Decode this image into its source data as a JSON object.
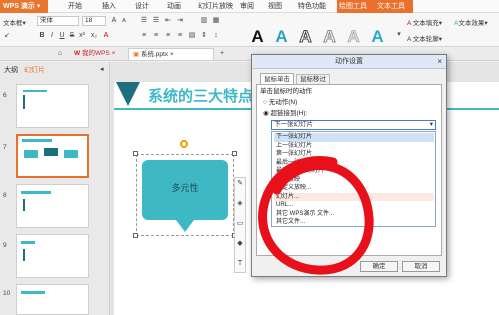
{
  "colors": {
    "accent": "#e9712b",
    "teal": "#3fb8c6",
    "dark_teal": "#1d6f7d",
    "red_annotation": "#e8101a"
  },
  "app": {
    "name": "WPS 演示"
  },
  "menu": {
    "items": [
      "开始",
      "插入",
      "设计",
      "动画",
      "幻灯片放映",
      "审阅",
      "视图",
      "特色功能"
    ],
    "drawing_tools": "绘图工具",
    "text_tools": "文本工具"
  },
  "ribbon": {
    "textbox_label": "文本框",
    "font_name": "宋体",
    "font_size": "18",
    "text_fill_label": "文本填充",
    "text_outline_label": "文本轮廓",
    "text_effect_label": "文本效果"
  },
  "tabs": {
    "my_wps": "我的WPS",
    "file": "系统.pptx"
  },
  "left_panel": {
    "tab_outline": "大纲",
    "tab_slides": "幻灯片",
    "slide_numbers": [
      "6",
      "7",
      "8",
      "9",
      "10"
    ]
  },
  "slide": {
    "title": "系统的三大特点",
    "shape_text": "多元性"
  },
  "dialog": {
    "title": "动作设置",
    "tab_click": "鼠标单击",
    "tab_hover": "鼠标移过",
    "group_label": "单击鼠标时的动作",
    "option_none": "无动作(N)",
    "option_hyperlink": "超链接到(H):",
    "hyperlink_value": "下一张幻灯片",
    "list_items": [
      "下一张幻灯片",
      "上一张幻灯片",
      "第一张幻灯片",
      "最后一张幻灯片",
      "最近观看的幻灯片",
      "结束放映",
      "自定义放映...",
      "幻灯片...",
      "URL...",
      "其它 WPS演示 文件...",
      "其它文件..."
    ],
    "ok_label": "确定",
    "cancel_label": "取消"
  }
}
